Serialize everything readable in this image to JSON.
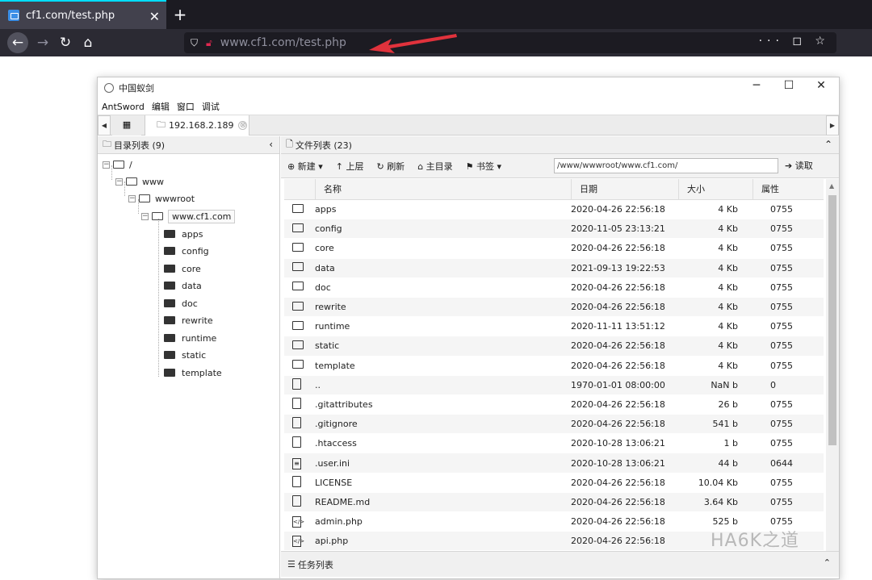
{
  "browser": {
    "tab_title": "cf1.com/test.php",
    "close_label": "✕",
    "new_tab_label": "+",
    "url": "www.cf1.com/test.php",
    "url_host_prefix": "www.cf1.com",
    "right_icons": "··· ◻ ☆"
  },
  "window": {
    "title": "中国蚁剑",
    "controls": {
      "minimize": "─",
      "maximize": "☐",
      "close": "✕"
    }
  },
  "menu": [
    "AntSword",
    "编辑",
    "窗口",
    "调试"
  ],
  "tabstrip": {
    "tab_label": "192.168.2.189",
    "tab_close": "⊗"
  },
  "left_panel": {
    "title": "目录列表 (9)",
    "toggle": "‹",
    "tree": {
      "root": "/",
      "www": "www",
      "wwwroot": "wwwroot",
      "site": "www.cf1.com",
      "children": [
        "apps",
        "config",
        "core",
        "data",
        "doc",
        "rewrite",
        "runtime",
        "static",
        "template"
      ]
    }
  },
  "right_panel": {
    "title": "文件列表 (23)",
    "toggle": "⌃",
    "toolbar": {
      "new": "新建",
      "up": "上层",
      "refresh": "刷新",
      "home": "主目录",
      "bookmark": "书签",
      "path": "/www/wwwroot/www.cf1.com/",
      "read": "读取"
    },
    "columns": {
      "name": "名称",
      "date": "日期",
      "size": "大小",
      "attr": "属性"
    },
    "rows": [
      {
        "icon": "folder-icon",
        "name": "apps",
        "date": "2020-04-26 22:56:18",
        "size": "4 Kb",
        "attr": "0755"
      },
      {
        "icon": "folder-icon",
        "name": "config",
        "date": "2020-11-05 23:13:21",
        "size": "4 Kb",
        "attr": "0755"
      },
      {
        "icon": "folder-icon",
        "name": "core",
        "date": "2020-04-26 22:56:18",
        "size": "4 Kb",
        "attr": "0755"
      },
      {
        "icon": "folder-icon",
        "name": "data",
        "date": "2021-09-13 19:22:53",
        "size": "4 Kb",
        "attr": "0755"
      },
      {
        "icon": "folder-icon",
        "name": "doc",
        "date": "2020-04-26 22:56:18",
        "size": "4 Kb",
        "attr": "0755"
      },
      {
        "icon": "folder-icon",
        "name": "rewrite",
        "date": "2020-04-26 22:56:18",
        "size": "4 Kb",
        "attr": "0755"
      },
      {
        "icon": "folder-icon",
        "name": "runtime",
        "date": "2020-11-11 13:51:12",
        "size": "4 Kb",
        "attr": "0755"
      },
      {
        "icon": "folder-icon",
        "name": "static",
        "date": "2020-04-26 22:56:18",
        "size": "4 Kb",
        "attr": "0755"
      },
      {
        "icon": "folder-icon",
        "name": "template",
        "date": "2020-04-26 22:56:18",
        "size": "4 Kb",
        "attr": "0755"
      },
      {
        "icon": "file-icon",
        "name": "..",
        "date": "1970-01-01 08:00:00",
        "size": "NaN b",
        "attr": "0"
      },
      {
        "icon": "file-icon",
        "name": ".gitattributes",
        "date": "2020-04-26 22:56:18",
        "size": "26 b",
        "attr": "0755"
      },
      {
        "icon": "file-icon",
        "name": ".gitignore",
        "date": "2020-04-26 22:56:18",
        "size": "541 b",
        "attr": "0755"
      },
      {
        "icon": "file-icon",
        "name": ".htaccess",
        "date": "2020-10-28 13:06:21",
        "size": "1 b",
        "attr": "0755"
      },
      {
        "icon": "text-file-icon",
        "name": ".user.ini",
        "date": "2020-10-28 13:06:21",
        "size": "44 b",
        "attr": "0644"
      },
      {
        "icon": "file-icon",
        "name": "LICENSE",
        "date": "2020-04-26 22:56:18",
        "size": "10.04 Kb",
        "attr": "0755"
      },
      {
        "icon": "file-icon",
        "name": "README.md",
        "date": "2020-04-26 22:56:18",
        "size": "3.64 Kb",
        "attr": "0755"
      },
      {
        "icon": "php-file-icon",
        "name": "admin.php",
        "date": "2020-04-26 22:56:18",
        "size": "525 b",
        "attr": "0755"
      },
      {
        "icon": "php-file-icon",
        "name": "api.php",
        "date": "2020-04-26 22:56:18",
        "size": "",
        "attr": ""
      }
    ]
  },
  "bottom_panel": {
    "title": "任务列表",
    "toggle": "⌃"
  },
  "watermark": "HA6K之道",
  "colors": {
    "accent": "#00ddff",
    "arrow": "#e0323c",
    "browser_bg": "#1c1b22"
  }
}
